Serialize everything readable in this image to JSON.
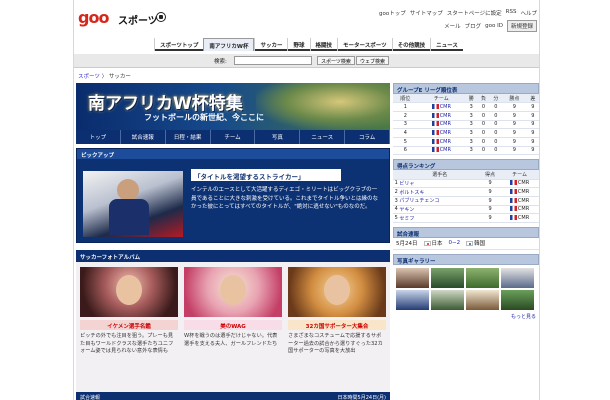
{
  "header": {
    "logo": "goo",
    "section": "スポーツ",
    "toplinks": [
      "gooトップ",
      "サイトマップ",
      "スタートページに設定",
      "RSS",
      "ヘルプ"
    ],
    "userlinks": [
      "メール",
      "ブログ",
      "goo ID"
    ],
    "register_label": "新規登録"
  },
  "nav": {
    "items": [
      "スポーツトップ",
      "南アフリカW杯",
      "サッカー",
      "野球",
      "格闘技",
      "モータースポーツ",
      "その他競技",
      "ニュース"
    ],
    "active_index": 1
  },
  "search": {
    "label": "検索:",
    "value": "",
    "sports_button": "スポーツ検索",
    "web_button": "ウェブ検索"
  },
  "breadcrumb": {
    "home": "スポーツ",
    "sep": "〉",
    "current": "サッカー"
  },
  "banner": {
    "title": "南アフリカW杯特集",
    "subtitle": "フットボールの新世紀、今ここに"
  },
  "tabs": [
    "トップ",
    "試合速報",
    "日程・結果",
    "チーム",
    "写真",
    "ニュース",
    "コラム"
  ],
  "pickup": {
    "heading": "ピックアップ",
    "title": "「タイトルを渇望するストライカー」",
    "body": "インテルのエースとして大活躍するディエゴ・ミリートはビッグクラブの一員であることに大きな刺激を受けている。これまでタイトル争いとは縁のなかった彼にとってはすべてのタイトルが、\"絶対に逃せない\"ものなのだ。"
  },
  "album": {
    "heading": "サッカーフォトアルバム",
    "cards": [
      {
        "title": "イケメン選手名鑑",
        "desc": "ピッチの外でも注目を狙う。プレーも見た目もワールドクラスな選手たちユニフォーム姿では見られない意外な表情も"
      },
      {
        "title": "美のWAG",
        "desc": "W杯を戦うのは選手だけじゃない。代表選手を支える夫人、ガールフレンドたち"
      },
      {
        "title": "32カ国サポーター大集合",
        "desc": "さまざまなコスチュームで応援するサポーター過去の試合から選りすぐった32カ国サポーターの写真を大放出"
      }
    ],
    "footer_left": "試合速報",
    "footer_right": "日本時間5月24日(月)"
  },
  "standings": {
    "heading": "グループE リーグ順位表",
    "columns": [
      "順位",
      "チーム",
      "勝",
      "負",
      "分",
      "勝点",
      "差"
    ],
    "rows": [
      [
        "1",
        "CMR",
        "3",
        "0",
        "0",
        "9",
        "9"
      ],
      [
        "2",
        "CMR",
        "3",
        "0",
        "0",
        "9",
        "9"
      ],
      [
        "3",
        "CMR",
        "3",
        "0",
        "0",
        "9",
        "9"
      ],
      [
        "4",
        "CMR",
        "3",
        "0",
        "0",
        "9",
        "9"
      ],
      [
        "5",
        "CMR",
        "3",
        "0",
        "0",
        "9",
        "9"
      ],
      [
        "6",
        "CMR",
        "3",
        "0",
        "0",
        "9",
        "9"
      ]
    ]
  },
  "scorers": {
    "heading": "得点ランキング",
    "columns": [
      "",
      "選手名",
      "得点",
      "チーム"
    ],
    "rows": [
      [
        "1",
        "ビリャ",
        "9",
        "CMR"
      ],
      [
        "2",
        "ボルトスキ",
        "9",
        "CMR"
      ],
      [
        "3",
        "パブリュチェンコ",
        "9",
        "CMR"
      ],
      [
        "4",
        "ヤキン",
        "9",
        "CMR"
      ],
      [
        "5",
        "セミフ",
        "9",
        "CMR"
      ]
    ]
  },
  "match": {
    "heading": "試合速報",
    "date": "5月24日",
    "home": "日本",
    "score": "0−2",
    "away": "韓国"
  },
  "gallery": {
    "heading": "写真ギャラリー",
    "more": "もっと見る"
  }
}
